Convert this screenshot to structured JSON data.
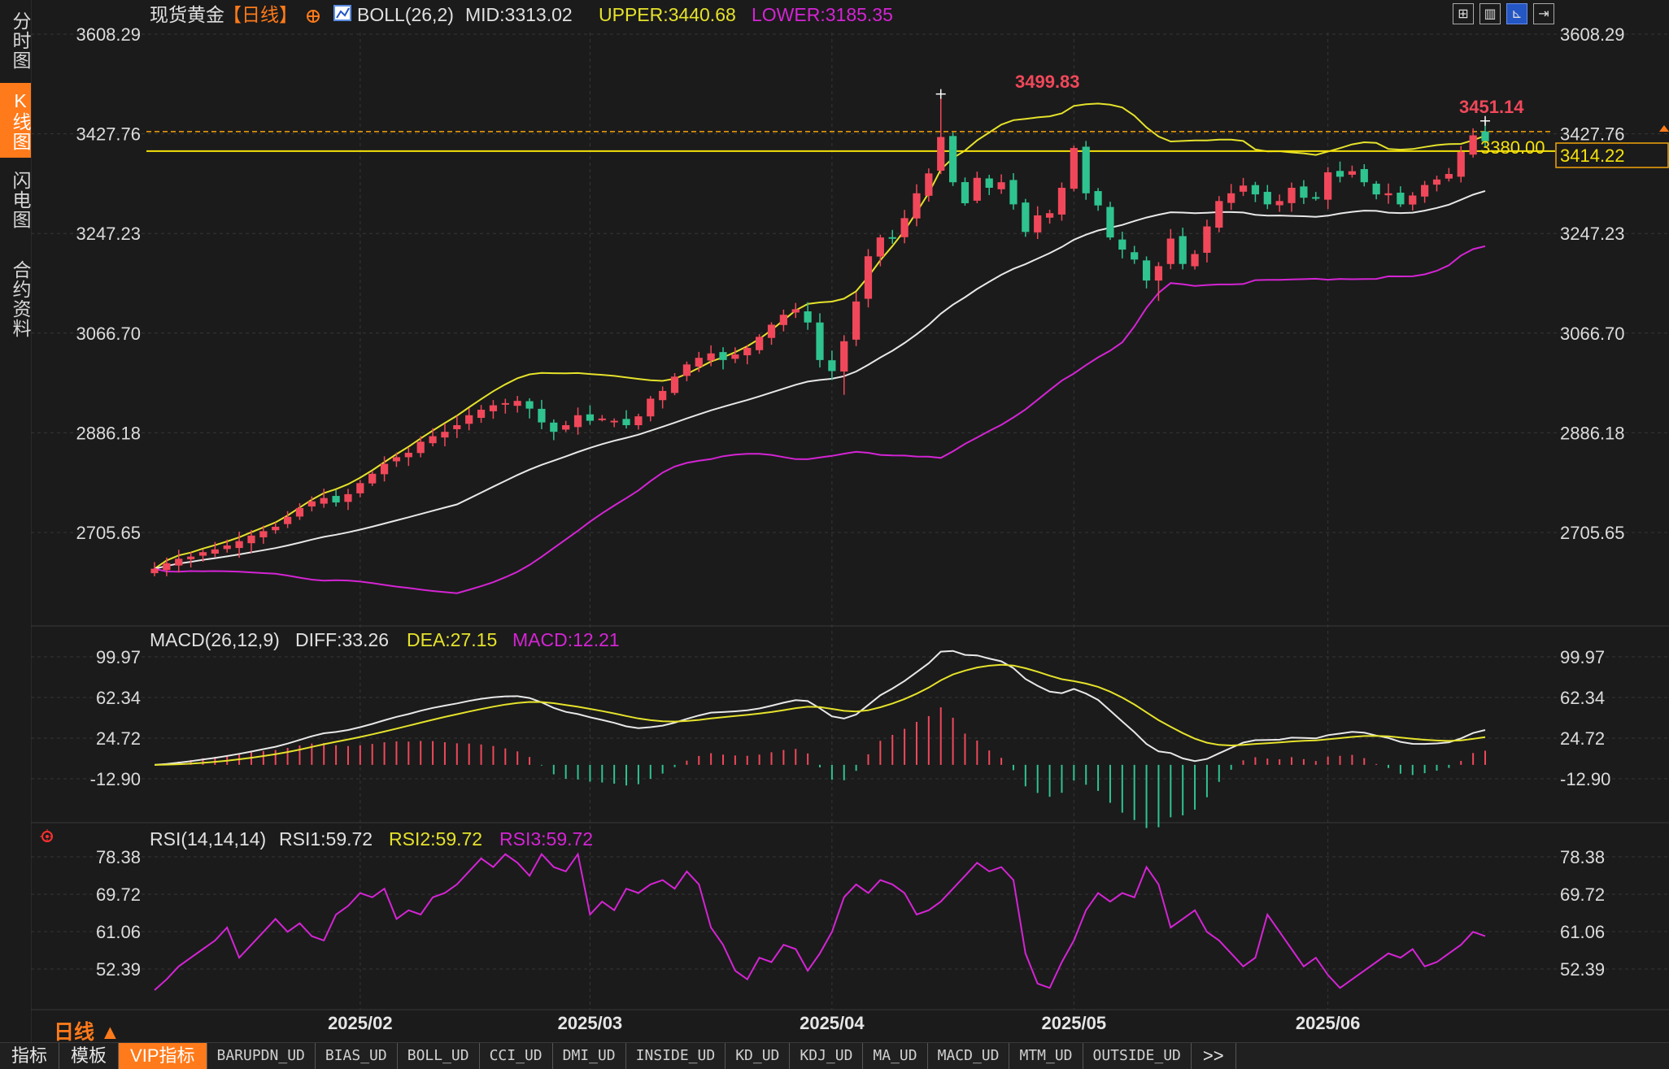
{
  "window": {
    "instrument": "现货黄金",
    "period_tag": "【日线】",
    "period_label": "日线 ▲"
  },
  "sidebar": {
    "tabs": [
      {
        "label": "分时图",
        "active": false
      },
      {
        "label": "K线图",
        "active": true
      },
      {
        "label": "闪电图",
        "active": false
      },
      {
        "label": "合约资料",
        "active": false
      }
    ]
  },
  "colors": {
    "up": "#f0485a",
    "down": "#2fc38f",
    "mid": "#e8e8e8",
    "upper": "#e5e22b",
    "lower": "#d424d4",
    "dea": "#e5e22b",
    "macd_bar_up": "#f0485a",
    "macd_bar_down": "#2fc38f",
    "accent": "#ff7a1a",
    "label_red": "#f0485a",
    "label_yellow": "#f5e10a"
  },
  "main_panel": {
    "legend": {
      "boll": "BOLL(26,2)",
      "mid": "MID:3313.02",
      "upper": "UPPER:3440.68",
      "lower": "LOWER:3185.35"
    },
    "y_min": 2620,
    "y_max": 3608.29,
    "y_ticks": [
      "3608.29",
      "3427.76",
      "3247.23",
      "3066.70",
      "2886.18",
      "2705.65"
    ],
    "annotations": {
      "high": {
        "label": "3499.83",
        "value": 3499.83
      },
      "last_high": {
        "label": "3451.14",
        "value": 3451.14
      },
      "dashed_line": {
        "label": "3380.00",
        "value": 3431.8
      },
      "price_line": {
        "label": "3414.22",
        "value": 3396.5
      }
    }
  },
  "macd_panel": {
    "legend": {
      "name": "MACD(26,12,9)",
      "diff": "DIFF:33.26",
      "dea": "DEA:27.15",
      "macd": "MACD:12.21"
    },
    "y_min": -30,
    "y_max": 110,
    "y_ticks": [
      "99.97",
      "62.34",
      "24.72",
      "-12.90"
    ]
  },
  "rsi_panel": {
    "legend": {
      "name": "RSI(14,14,14)",
      "rsi1": "RSI1:59.72",
      "rsi2": "RSI2:59.72",
      "rsi3": "RSI3:59.72"
    },
    "y_min": 46,
    "y_max": 82,
    "y_ticks": [
      "78.38",
      "69.72",
      "61.06",
      "52.39"
    ]
  },
  "x_axis": {
    "labels": [
      {
        "label": "2025/02",
        "index": 17
      },
      {
        "label": "2025/03",
        "index": 36
      },
      {
        "label": "2025/04",
        "index": 56
      },
      {
        "label": "2025/05",
        "index": 76
      },
      {
        "label": "2025/06",
        "index": 97
      }
    ]
  },
  "bottom_tabs": [
    "指标",
    "模板",
    "VIP指标",
    "BARUPDN_UD",
    "BIAS_UD",
    "BOLL_UD",
    "CCI_UD",
    "DMI_UD",
    "INSIDE_UD",
    "KD_UD",
    "KDJ_UD",
    "MA_UD",
    "MACD_UD",
    "MTM_UD",
    "OUTSIDE_UD",
    ">>"
  ],
  "bottom_tab_active": "VIP指标",
  "chart_data": {
    "type": "candlestick",
    "instrument": "现货黄金",
    "series_close": [
      2640,
      2650,
      2658,
      2662,
      2670,
      2675,
      2682,
      2690,
      2700,
      2708,
      2716,
      2734,
      2750,
      2762,
      2768,
      2760,
      2775,
      2795,
      2812,
      2830,
      2842,
      2850,
      2870,
      2880,
      2888,
      2900,
      2918,
      2928,
      2936,
      2940,
      2944,
      2930,
      2905,
      2888,
      2900,
      2918,
      2908,
      2912,
      2908,
      2900,
      2916,
      2948,
      2962,
      2988,
      3010,
      3022,
      3030,
      3018,
      3028,
      3040,
      3060,
      3082,
      3100,
      3110,
      3086,
      3018,
      2998,
      3052,
      3124,
      3206,
      3240,
      3238,
      3275,
      3320,
      3356,
      3422,
      3340,
      3302,
      3348,
      3330,
      3340,
      3300,
      3250,
      3280,
      3284,
      3330,
      3402,
      3320,
      3298,
      3240,
      3218,
      3200,
      3162,
      3188,
      3238,
      3192,
      3210,
      3260,
      3306,
      3320,
      3334,
      3318,
      3300,
      3306,
      3330,
      3312,
      3312,
      3358,
      3350,
      3360,
      3340,
      3318,
      3320,
      3300,
      3316,
      3335,
      3345,
      3355,
      3395,
      3425,
      3414
    ],
    "last": {
      "open": 3432,
      "high": 3451.14,
      "low": 3405,
      "close": 3414.22
    },
    "boll": {
      "mid": 3313.02,
      "upper": 3440.68,
      "lower": 3185.35
    },
    "macd": {
      "diff": 33.26,
      "dea": 27.15,
      "macd": 12.21
    },
    "rsi": {
      "rsi1": 59.72,
      "rsi2": 59.72,
      "rsi3": 59.72
    },
    "rsi_series": [
      47.5,
      50,
      53,
      55,
      57,
      59,
      62,
      55,
      58,
      61,
      64,
      61,
      63,
      60,
      59,
      65,
      67,
      70,
      69,
      71,
      64,
      66,
      65,
      69,
      70,
      72,
      75,
      78,
      76,
      79,
      77,
      74,
      79,
      76,
      75,
      79,
      65,
      68,
      66,
      71,
      70,
      72,
      73,
      71,
      75,
      72,
      62,
      58,
      52,
      50,
      55,
      54,
      58,
      57,
      52,
      56,
      61,
      69,
      72,
      70,
      73,
      72,
      70,
      65,
      66,
      68,
      71,
      74,
      77,
      75,
      76,
      73,
      56,
      49,
      48,
      54,
      59,
      66,
      70,
      68,
      70,
      69,
      76,
      72,
      62,
      64,
      66,
      61,
      59,
      56,
      53,
      55,
      65,
      61,
      57,
      53,
      55,
      51,
      48,
      50,
      52,
      54,
      56,
      55,
      57,
      53,
      54,
      56,
      58,
      61,
      60
    ]
  }
}
